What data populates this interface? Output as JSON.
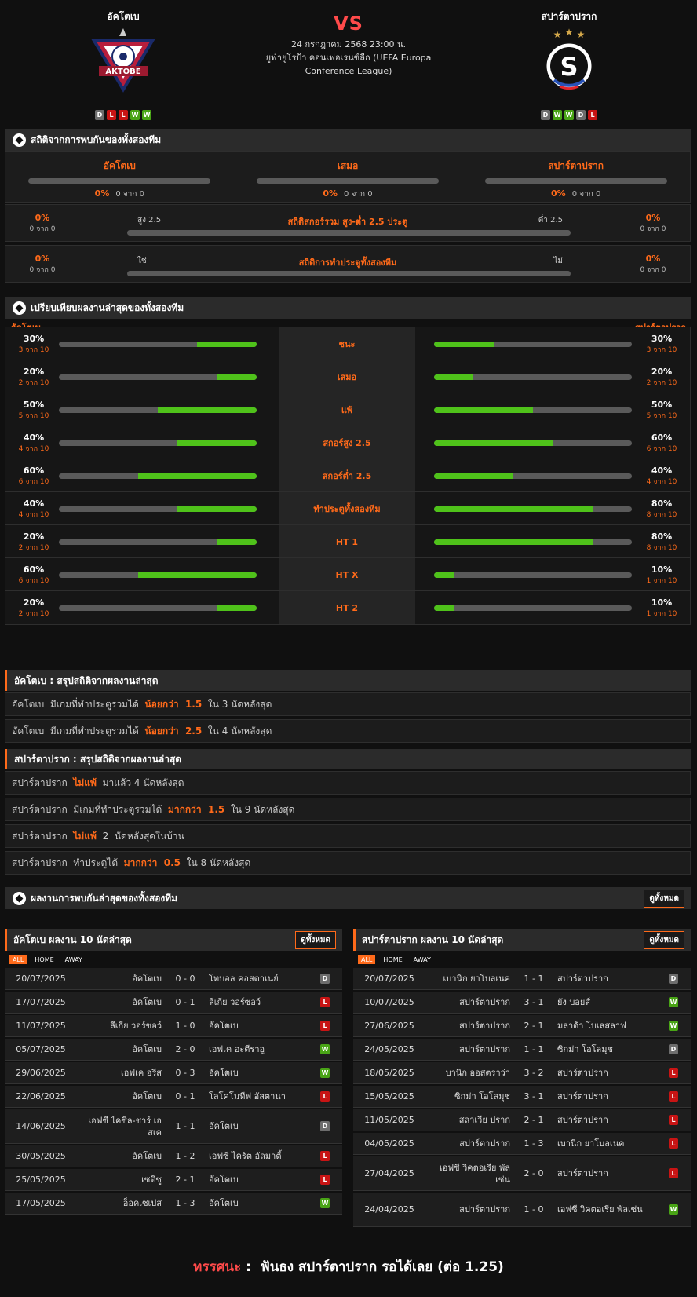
{
  "match": {
    "home": "อัคโตเบ",
    "away": "สปาร์ตาปราก",
    "vs": "VS",
    "date": "24 กรกฎาคม 2568 23:00 น.",
    "comp1": "ยูฟ่ายูโรป้า คอนเฟอเรนซ์ลีก (UEFA Europa",
    "comp2": "Conference League)",
    "home_form": [
      "D",
      "L",
      "L",
      "W",
      "W"
    ],
    "away_form": [
      "D",
      "W",
      "W",
      "D",
      "L"
    ],
    "home_logo_text": "AKTOBE",
    "away_logo_text": "S"
  },
  "h2h": {
    "title": "สถิติจากการพบกันของทั้งสองทีม",
    "cols": [
      {
        "label": "อัคโตเบ",
        "pct": "0%",
        "sub": "0 จาก 0"
      },
      {
        "label": "เสมอ",
        "pct": "0%",
        "sub": "0 จาก 0"
      },
      {
        "label": "สปาร์ตาปราก",
        "pct": "0%",
        "sub": "0 จาก 0"
      }
    ],
    "ou": {
      "title": "สถิติสกอร์รวม สูง-ต่ำ 2.5 ประตู",
      "left_label": "สูง 2.5",
      "right_label": "ต่ำ 2.5",
      "lp": "0%",
      "ls": "0 จาก 0",
      "rp": "0%",
      "rs": "0 จาก 0"
    },
    "btts": {
      "title": "สถิติการทำประตูทั้งสองทีม",
      "left_label": "ใช่",
      "right_label": "ไม่",
      "lp": "0%",
      "ls": "0 จาก 0",
      "rp": "0%",
      "rs": "0 จาก 0"
    }
  },
  "compare": {
    "title": "เปรียบเทียบผลงานล่าสุดของทั้งสองทีม",
    "home": "อัคโตเบ",
    "away": "สปาร์ตาปราก",
    "rows": [
      {
        "label": "ชนะ",
        "hp": "30%",
        "hs": "3 จาก 10",
        "hv": 0.3,
        "ap": "30%",
        "as": "3 จาก 10",
        "av": 0.3
      },
      {
        "label": "เสมอ",
        "hp": "20%",
        "hs": "2 จาก 10",
        "hv": 0.2,
        "ap": "20%",
        "as": "2 จาก 10",
        "av": 0.2
      },
      {
        "label": "แพ้",
        "hp": "50%",
        "hs": "5 จาก 10",
        "hv": 0.5,
        "ap": "50%",
        "as": "5 จาก 10",
        "av": 0.5
      },
      {
        "label": "สกอร์สูง 2.5",
        "hp": "40%",
        "hs": "4 จาก 10",
        "hv": 0.4,
        "ap": "60%",
        "as": "6 จาก 10",
        "av": 0.6
      },
      {
        "label": "สกอร์ต่ำ 2.5",
        "hp": "60%",
        "hs": "6 จาก 10",
        "hv": 0.6,
        "ap": "40%",
        "as": "4 จาก 10",
        "av": 0.4
      },
      {
        "label": "ทำประตูทั้งสองทีม",
        "hp": "40%",
        "hs": "4 จาก 10",
        "hv": 0.4,
        "ap": "80%",
        "as": "8 จาก 10",
        "av": 0.8
      },
      {
        "label": "HT 1",
        "hp": "20%",
        "hs": "2 จาก 10",
        "hv": 0.2,
        "ap": "80%",
        "as": "8 จาก 10",
        "av": 0.8
      },
      {
        "label": "HT X",
        "hp": "60%",
        "hs": "6 จาก 10",
        "hv": 0.6,
        "ap": "10%",
        "as": "1 จาก 10",
        "av": 0.1
      },
      {
        "label": "HT 2",
        "hp": "20%",
        "hs": "2 จาก 10",
        "hv": 0.2,
        "ap": "10%",
        "as": "1 จาก 10",
        "av": 0.1
      }
    ]
  },
  "home_summary": {
    "title": "อัคโตเบ : สรุปสถิติจากผลงานล่าสุด",
    "rows": [
      {
        "pre": "อัคโตเบ  มีเกมที่ทำประตูรวมได้  ",
        "hl": "น้อยกว่า  1.5",
        "post": "  ใน 3 นัดหลังสุด"
      },
      {
        "pre": "อัคโตเบ  มีเกมที่ทำประตูรวมได้  ",
        "hl": "น้อยกว่า  2.5",
        "post": "  ใน 4 นัดหลังสุด"
      }
    ]
  },
  "away_summary": {
    "title": "สปาร์ตาปราก : สรุปสถิติจากผลงานล่าสุด",
    "rows": [
      {
        "pre": "สปาร์ตาปราก  ",
        "hl": "ไม่แพ้",
        "post": "  มาแล้ว 4 นัดหลังสุด"
      },
      {
        "pre": "สปาร์ตาปราก  มีเกมที่ทำประตูรวมได้  ",
        "hl": "มากกว่า  1.5",
        "post": "  ใน 9 นัดหลังสุด"
      },
      {
        "pre": "สปาร์ตาปราก  ",
        "hl": "ไม่แพ้",
        "post": "  2  นัดหลังสุดในบ้าน"
      },
      {
        "pre": "สปาร์ตาปราก  ทำประตูได้  ",
        "hl": "มากกว่า  0.5",
        "post": "  ใน 8 นัดหลังสุด"
      }
    ]
  },
  "recent": {
    "title": "ผลงานการพบกันล่าสุดของทั้งสองทีม",
    "view_all": "ดูทั้งหมด",
    "tabs": [
      "ALL",
      "HOME",
      "AWAY"
    ],
    "home_title": "อัคโตเบ ผลงาน 10 นัดล่าสุด",
    "away_title": "สปาร์ตาปราก ผลงาน 10 นัดล่าสุด",
    "home_matches": [
      {
        "d": "20/07/2025",
        "h": "อัคโตเบ",
        "s": "0 - 0",
        "a": "โทบอล คอสตาเนย์",
        "r": "D"
      },
      {
        "d": "17/07/2025",
        "h": "อัคโตเบ",
        "s": "0 - 1",
        "a": "ลีเกีย วอร์ซอว์",
        "r": "L"
      },
      {
        "d": "11/07/2025",
        "h": "ลีเกีย วอร์ซอว์",
        "s": "1 - 0",
        "a": "อัคโตเบ",
        "r": "L"
      },
      {
        "d": "05/07/2025",
        "h": "อัคโตเบ",
        "s": "2 - 0",
        "a": "เอฟเค อะตีราอู",
        "r": "W"
      },
      {
        "d": "29/06/2025",
        "h": "เอฟเค อรีส",
        "s": "0 - 3",
        "a": "อัคโตเบ",
        "r": "W"
      },
      {
        "d": "22/06/2025",
        "h": "อัคโตเบ",
        "s": "0 - 1",
        "a": "โลโคโมทีฟ อัสตานา",
        "r": "L"
      },
      {
        "d": "14/06/2025",
        "h": "เอฟซี ไคซิล-ชาร์ เอสเค",
        "s": "1 - 1",
        "a": "อัคโตเบ",
        "r": "D"
      },
      {
        "d": "30/05/2025",
        "h": "อัคโตเบ",
        "s": "1 - 2",
        "a": "เอฟซี ไครัต อัลมาตี้",
        "r": "L"
      },
      {
        "d": "25/05/2025",
        "h": "เซติซู",
        "s": "2 - 1",
        "a": "อัคโตเบ",
        "r": "L"
      },
      {
        "d": "17/05/2025",
        "h": "อ็อคเซเปส",
        "s": "1 - 3",
        "a": "อัคโตเบ",
        "r": "W"
      }
    ],
    "away_matches": [
      {
        "d": "20/07/2025",
        "h": "เบานิก ยาโบลเนค",
        "s": "1 - 1",
        "a": "สปาร์ตาปราก",
        "r": "D"
      },
      {
        "d": "10/07/2025",
        "h": "สปาร์ตาปราก",
        "s": "3 - 1",
        "a": "ยัง บอยส์",
        "r": "W"
      },
      {
        "d": "27/06/2025",
        "h": "สปาร์ตาปราก",
        "s": "2 - 1",
        "a": "มลาด้า โบเลสลาฟ",
        "r": "W"
      },
      {
        "d": "24/05/2025",
        "h": "สปาร์ตาปราก",
        "s": "1 - 1",
        "a": "ซิกม่า โอโลมุช",
        "r": "D"
      },
      {
        "d": "18/05/2025",
        "h": "บานิก ออสตราว่า",
        "s": "3 - 2",
        "a": "สปาร์ตาปราก",
        "r": "L"
      },
      {
        "d": "15/05/2025",
        "h": "ซิกม่า โอโลมุช",
        "s": "3 - 1",
        "a": "สปาร์ตาปราก",
        "r": "L"
      },
      {
        "d": "11/05/2025",
        "h": "สลาเวีย ปราก",
        "s": "2 - 1",
        "a": "สปาร์ตาปราก",
        "r": "L"
      },
      {
        "d": "04/05/2025",
        "h": "สปาร์ตาปราก",
        "s": "1 - 3",
        "a": "เบานิก ยาโบลเนค",
        "r": "L"
      },
      {
        "d": "27/04/2025",
        "h": "เอฟซี วิคตอเรีย พัลเซ่น",
        "s": "2 - 0",
        "a": "สปาร์ตาปราก",
        "r": "L"
      },
      {
        "d": "24/04/2025",
        "h": "สปาร์ตาปราก",
        "s": "1 - 0",
        "a": "เอฟซี วิคตอเรีย พัลเซ่น",
        "r": "W"
      }
    ]
  },
  "verdict": {
    "key": "ทรรศนะ",
    "sep": " :  ",
    "text": "ฟันธง สปาร์ตาปราก รอได้เลย (ต่อ 1.25)"
  },
  "colors": {
    "accent": "#ff6a1a",
    "bar_fill": "#4fc21a",
    "win": "#49a416",
    "loss": "#c81414",
    "draw": "#6d6d6d"
  }
}
